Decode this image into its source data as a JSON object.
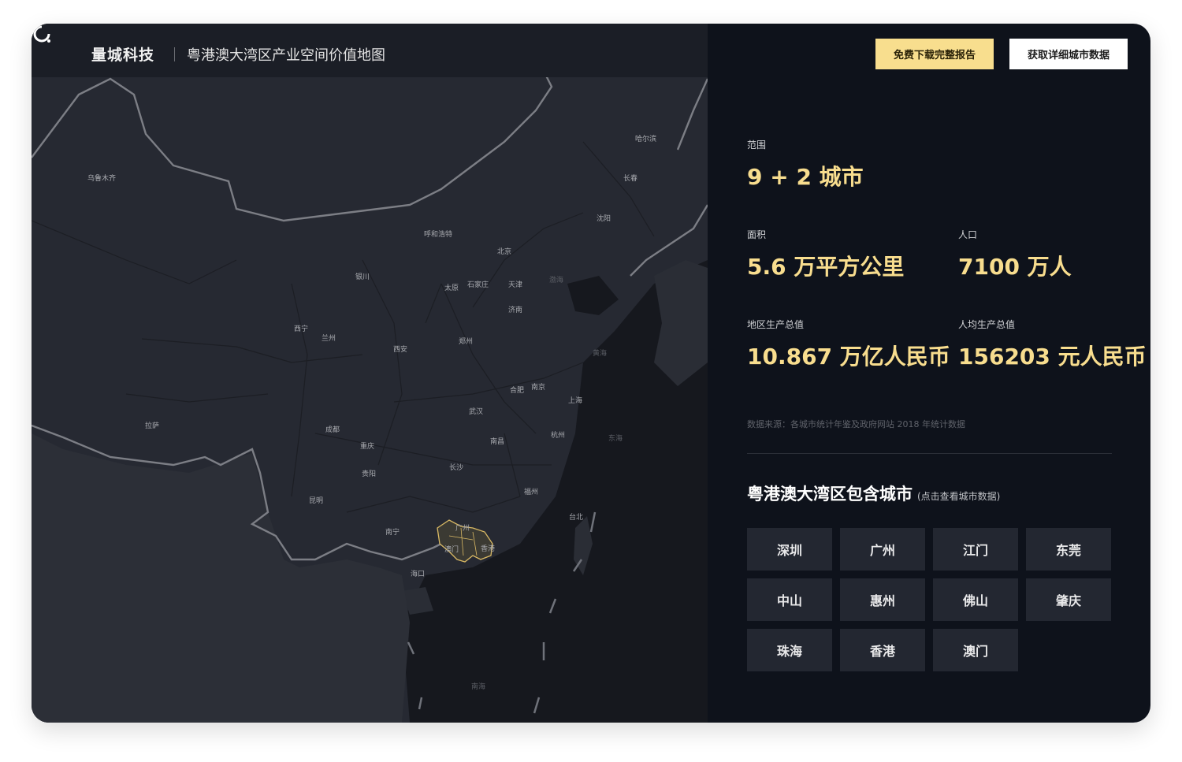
{
  "header": {
    "brand": "量城科技",
    "map_title": "粤港澳大湾区产业空间价值地图",
    "btn_download": "免费下载完整报告",
    "btn_data": "获取详细城市数据"
  },
  "map": {
    "cities": [
      "乌鲁木齐",
      "哈尔滨",
      "长春",
      "沈阳",
      "呼和浩特",
      "北京",
      "银川",
      "太原",
      "石家庄",
      "天津",
      "济南",
      "西宁",
      "兰州",
      "郑州",
      "西安",
      "合肥",
      "南京",
      "上海",
      "武汉",
      "拉萨",
      "成都",
      "重庆",
      "南昌",
      "杭州",
      "长沙",
      "贵阳",
      "福州",
      "昆明",
      "南宁",
      "广州",
      "澳门",
      "香港",
      "台北",
      "海口"
    ],
    "seas": [
      "渤海",
      "黄海",
      "东海",
      "南海"
    ]
  },
  "stats": {
    "scope_label": "范围",
    "scope_value": "9 + 2 城市",
    "area_label": "面积",
    "area_value": "5.6 万平方公里",
    "population_label": "人口",
    "population_value": "7100 万人",
    "gdp_label": "地区生产总值",
    "gdp_value": "10.867 万亿人民币",
    "gdp_per_capita_label": "人均生产总值",
    "gdp_per_capita_value": "156203 元人民币"
  },
  "source_note": "数据来源：各城市统计年鉴及政府网站 2018 年统计数据",
  "cities_section": {
    "title": "粤港澳大湾区包含城市",
    "note": "(点击查看城市数据)",
    "cities": [
      "深圳",
      "广州",
      "江门",
      "东莞",
      "中山",
      "惠州",
      "佛山",
      "肇庆",
      "珠海",
      "香港",
      "澳门"
    ]
  },
  "colors": {
    "accent": "#f8de8e",
    "panel_bg": "#0e121b",
    "map_bg": "#262932"
  }
}
